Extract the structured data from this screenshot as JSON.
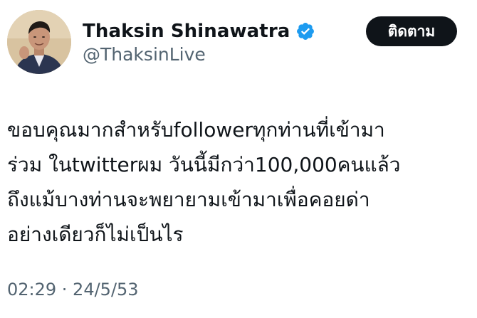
{
  "author": {
    "display_name": "Thaksin Shinawatra",
    "handle": "@ThaksinLive",
    "verified_icon": "verified-badge-icon",
    "accent_color": "#1d9bf0"
  },
  "follow_button": {
    "label": "ติดตาม"
  },
  "tweet": {
    "lines": [
      "ขอบคุณมากสำหรับfollowerทุกท่านที่เข้ามา",
      "ร่วม ในtwitterผม วันนี้มีกว่า100,000คนแล้ว",
      "ถึงแม้บางท่านจะพยายามเข้ามาเพื่อคอยด่า",
      "อย่างเดียวก็ไม่เป็นไร"
    ],
    "timestamp": "02:29 · 24/5/53"
  }
}
